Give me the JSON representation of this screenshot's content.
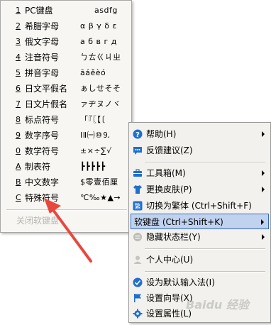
{
  "soft_keyboard_menu": {
    "items": [
      {
        "key": "1",
        "label": "PC键盘",
        "chars": "asdfg"
      },
      {
        "key": "2",
        "label": "希腊字母",
        "chars": "α β γ δ ε"
      },
      {
        "key": "3",
        "label": "俄文字母",
        "chars": "а б в г д"
      },
      {
        "key": "4",
        "label": "注音符号",
        "chars": "ㄅㄊㄍㄐㄓ"
      },
      {
        "key": "5",
        "label": "拼音字母",
        "chars": "āáěèó"
      },
      {
        "key": "6",
        "label": "日文平假名",
        "chars": "ぁしせそそ"
      },
      {
        "key": "7",
        "label": "日文片假名",
        "chars": "ァヂヌノヾ"
      },
      {
        "key": "8",
        "label": "标点符号",
        "chars": "「『〖【〔"
      },
      {
        "key": "9",
        "label": "数字序号",
        "chars": "ⅠⅡ㈠⑩⒐"
      },
      {
        "key": "0",
        "label": "数学符号",
        "chars": "±×÷∑√"
      },
      {
        "key": "A",
        "label": "制表符",
        "chars": "┣┣┣┣┣"
      },
      {
        "key": "B",
        "label": "中文数字",
        "chars": "$零壹佰厘"
      },
      {
        "key": "C",
        "label": "特殊符号",
        "chars": "℃‰★▲→"
      }
    ],
    "close_label": "关闭软键盘"
  },
  "main_menu": {
    "items": [
      {
        "label": "帮助(H)",
        "icon": "help-icon",
        "submenu": true
      },
      {
        "label": "反馈建议(Z)",
        "icon": "feedback-icon",
        "submenu": false
      },
      {
        "label": "工具箱(M)",
        "icon": "toolbox-icon",
        "submenu": true
      },
      {
        "label": "更换皮肤(P)",
        "icon": "skin-icon",
        "submenu": true
      },
      {
        "label": "切换为繁体 (Ctrl+Shift+F)",
        "icon": "traditional-icon",
        "submenu": false
      },
      {
        "label": "软键盘 (Ctrl+Shift+K)",
        "icon": "",
        "submenu": true
      },
      {
        "label": "隐藏状态栏(Y)",
        "icon": "statusbar-icon",
        "submenu": true
      },
      {
        "label": "个人中心(U)",
        "icon": "user-icon",
        "submenu": false
      },
      {
        "label": "设为默认输入法(I)",
        "icon": "check-icon",
        "submenu": false
      },
      {
        "label": "设置向导(X)",
        "icon": "flag-icon",
        "submenu": false
      },
      {
        "label": "设置属性(L)",
        "icon": "gear-icon",
        "submenu": false
      }
    ]
  },
  "colors": {
    "highlight_bg": "#c1d2ee",
    "highlight_border": "#316ac5",
    "annotation_red": "#e8473d",
    "icon_blue": "#1f6fcf"
  }
}
